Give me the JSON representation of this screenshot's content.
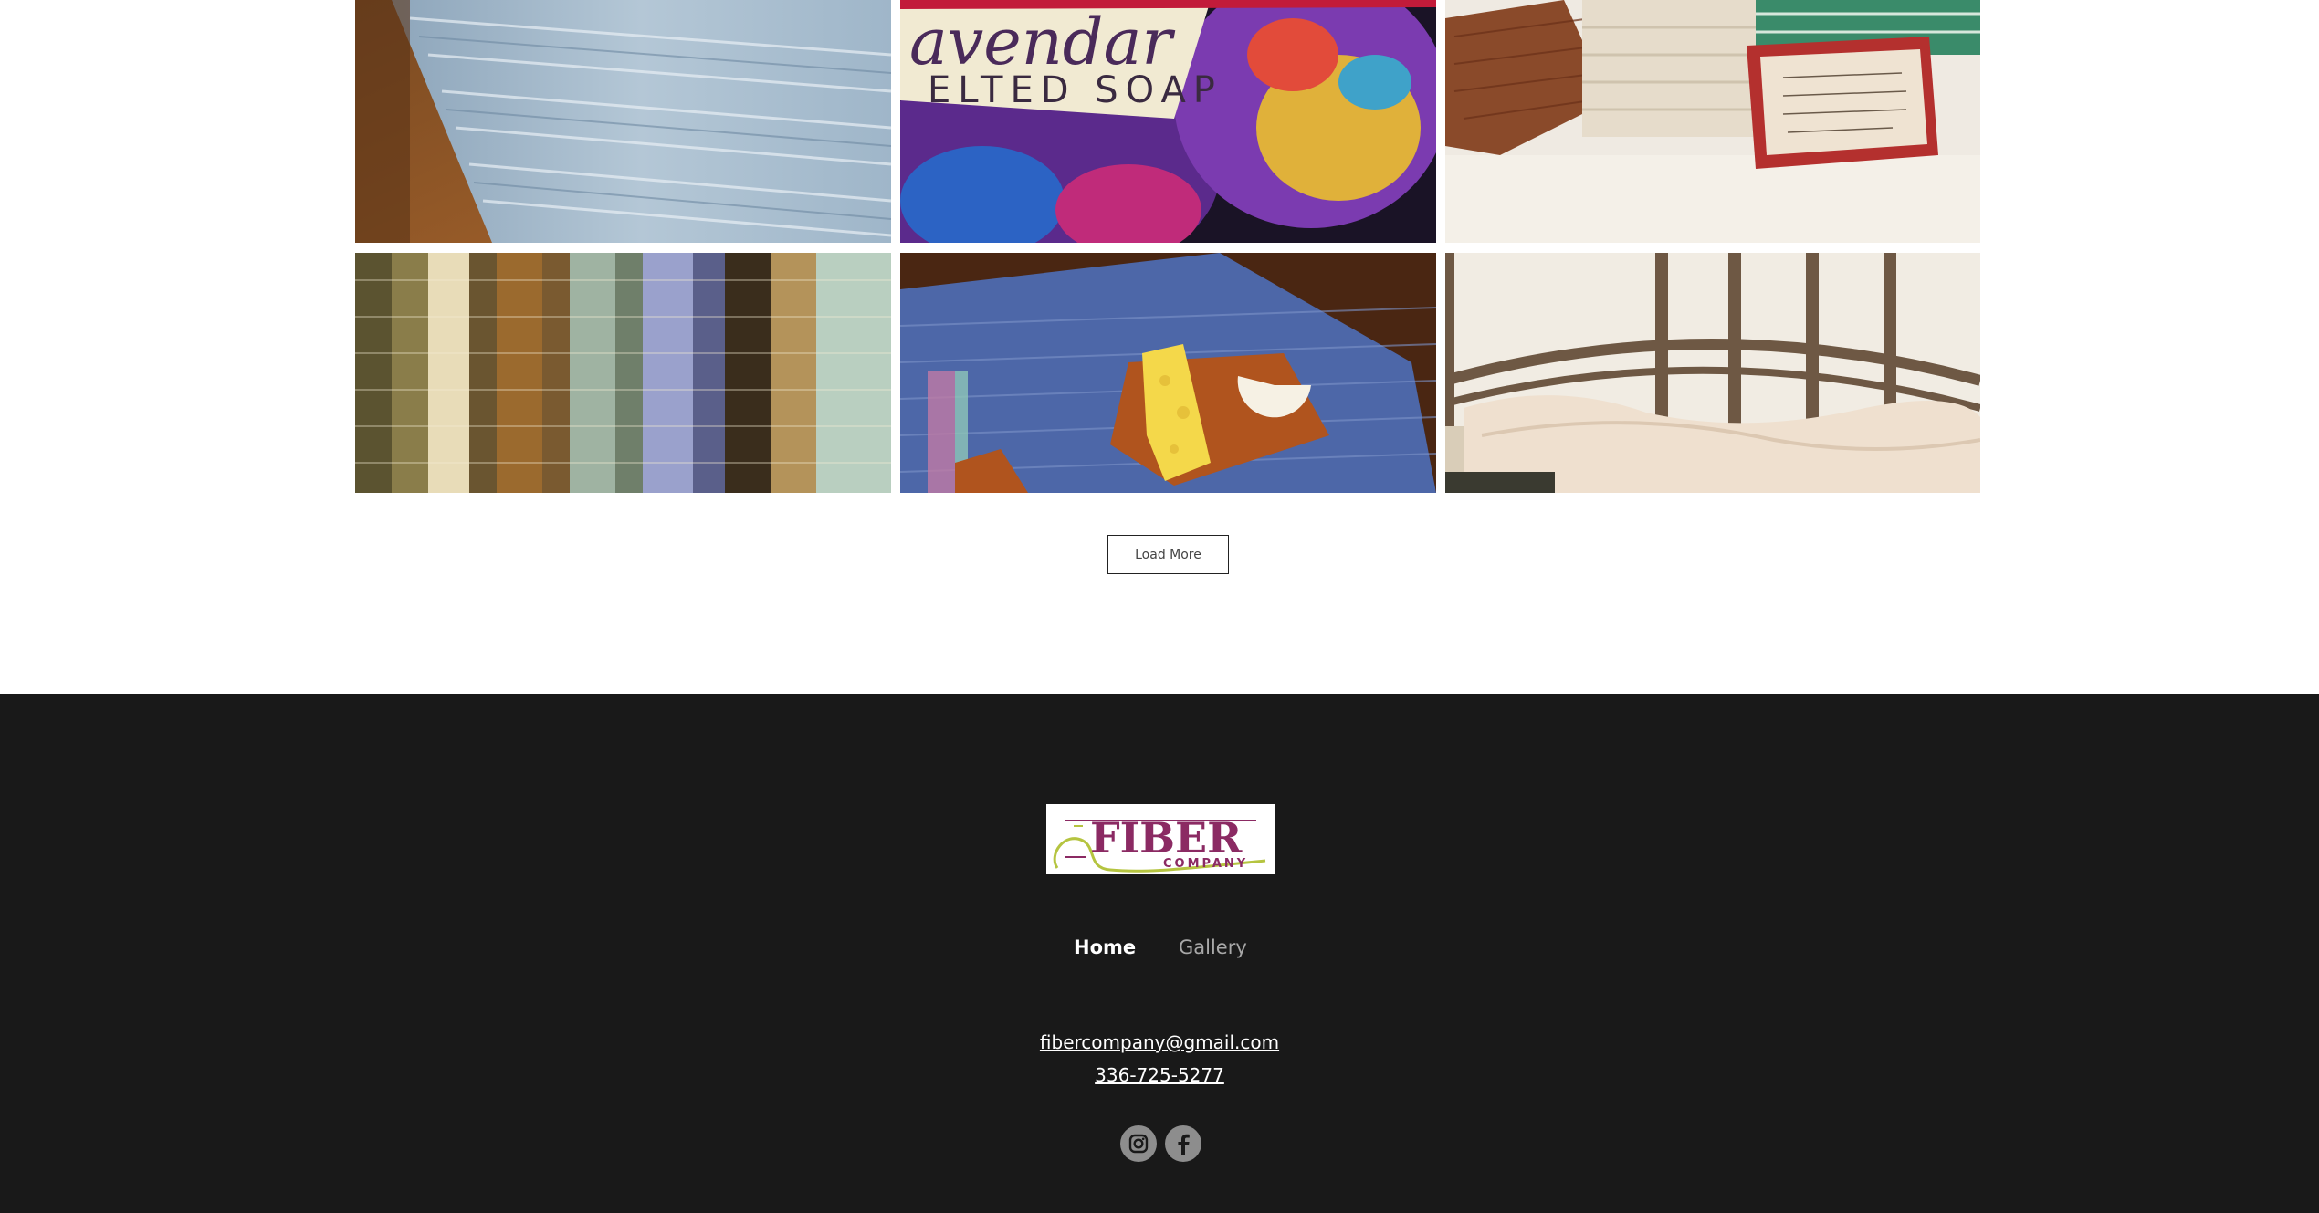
{
  "gallery": {
    "tiles": [
      {
        "alt": "woven-blue-fabric"
      },
      {
        "alt": "felted-soap"
      },
      {
        "alt": "pillows"
      },
      {
        "alt": "yarn-samples"
      },
      {
        "alt": "blue-placemat-cheese-board"
      },
      {
        "alt": "cream-throw-blanket"
      }
    ],
    "load_more_label": "Load More"
  },
  "footer": {
    "logo_text": "FIBER",
    "logo_subtext": "COMPANY",
    "nav": {
      "home": "Home",
      "gallery": "Gallery"
    },
    "email": "fibercompany@gmail.com",
    "phone": "336-725-5277",
    "social": [
      "instagram-icon",
      "facebook-icon"
    ]
  },
  "colors": {
    "footer_bg": "#191919",
    "logo_purple": "#8b2a63",
    "logo_green": "#b5c440"
  }
}
